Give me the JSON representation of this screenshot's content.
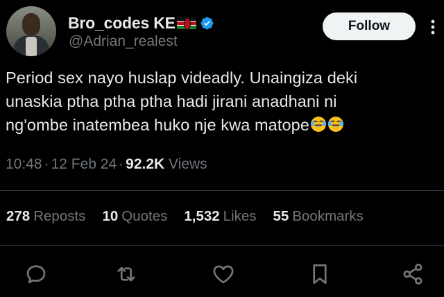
{
  "user": {
    "display_name": "Bro_codes KE",
    "flag_icon": "kenya-flag-icon",
    "verified_icon": "verified-badge-icon",
    "handle": "@Adrian_realest"
  },
  "follow_button": {
    "label": "Follow"
  },
  "tweet": {
    "lines": [
      "Period sex nayo huslap videadly. Unaingiza deki",
      "unaskia ptha ptha ptha hadi jirani anadhani ni",
      "ng'ombe inatembea huko nje kwa matope"
    ],
    "emojis": [
      "face-with-tears-of-joy",
      "face-with-tears-of-joy"
    ]
  },
  "meta": {
    "time": "10:48",
    "date": "12 Feb 24",
    "views_count": "92.2K",
    "views_label": "Views"
  },
  "stats": [
    {
      "num": "278",
      "label": "Reposts"
    },
    {
      "num": "10",
      "label": "Quotes"
    },
    {
      "num": "1,532",
      "label": "Likes"
    },
    {
      "num": "55",
      "label": "Bookmarks"
    }
  ],
  "actions": [
    "reply-icon",
    "repost-icon",
    "like-icon",
    "bookmark-icon",
    "share-icon"
  ],
  "colors": {
    "background": "#000000",
    "text_primary": "#e7e9ea",
    "text_secondary": "#71767b",
    "verified_blue": "#1d9bf0",
    "divider": "#2f3336",
    "follow_bg": "#eff3f4"
  }
}
